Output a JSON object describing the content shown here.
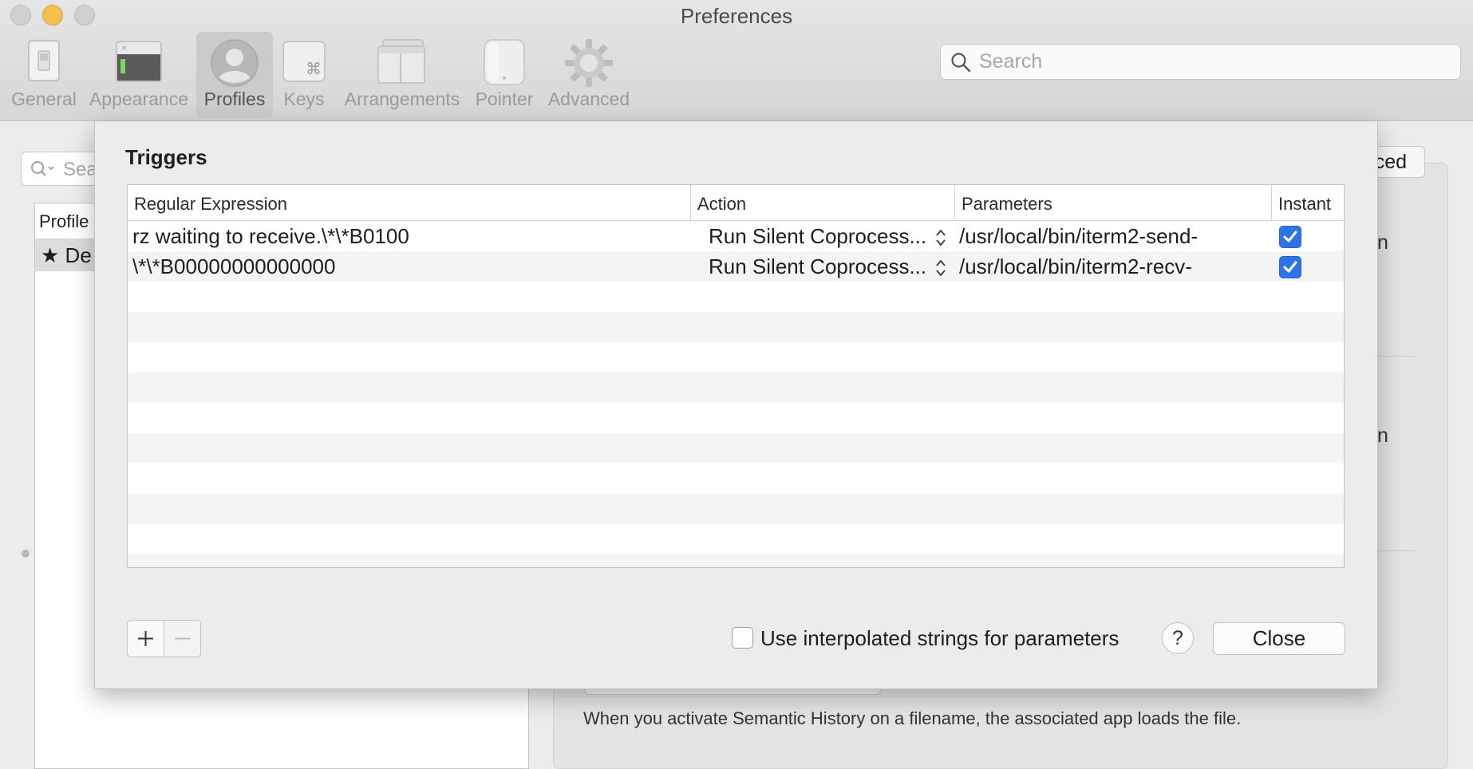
{
  "window": {
    "title": "Preferences"
  },
  "toolbar": {
    "items": [
      {
        "label": "General",
        "icon": "general-switch-icon"
      },
      {
        "label": "Appearance",
        "icon": "appearance-window-icon"
      },
      {
        "label": "Profiles",
        "icon": "profile-person-icon",
        "selected": true
      },
      {
        "label": "Keys",
        "icon": "command-key-icon"
      },
      {
        "label": "Arrangements",
        "icon": "window-arrangement-icon"
      },
      {
        "label": "Pointer",
        "icon": "mouse-icon"
      },
      {
        "label": "Advanced",
        "icon": "gear-icon"
      }
    ],
    "search_placeholder": "Search"
  },
  "background": {
    "profile_search_placeholder": "Sea",
    "profile_list_header": "Profile",
    "profile_row_name": "De",
    "tab_fragment": "ced",
    "fragment_1": "n",
    "fragment_2": "n",
    "semantic_history_note": "When you activate Semantic History on a filename, the associated app loads the file."
  },
  "triggers_sheet": {
    "title": "Triggers",
    "columns": {
      "regex": "Regular Expression",
      "action": "Action",
      "parameters": "Parameters",
      "instant": "Instant"
    },
    "rows": [
      {
        "regex": "rz waiting to receive.\\*\\*B0100",
        "action": "Run Silent Coprocess...",
        "parameters": "/usr/local/bin/iterm2-send-",
        "instant": true
      },
      {
        "regex": "\\*\\*B00000000000000",
        "action": "Run Silent Coprocess...",
        "parameters": "/usr/local/bin/iterm2-recv-",
        "instant": true
      }
    ],
    "interpolated_label": "Use interpolated strings for parameters",
    "interpolated_checked": false,
    "help_label": "?",
    "close_label": "Close"
  },
  "colors": {
    "accent": "#2f74e4",
    "traffic_yellow": "#f5bf4f",
    "stripe": "#f4f4f4"
  }
}
